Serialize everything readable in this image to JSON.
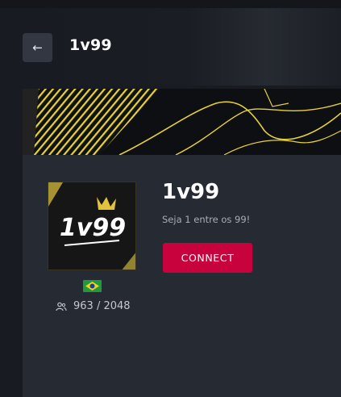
{
  "header": {
    "back_icon": "arrow-left-icon",
    "title": "1v99"
  },
  "server": {
    "name": "1v99",
    "description": "Seja 1 entre os 99!",
    "connect_label": "CONNECT",
    "country_flag": "brazil-flag-icon",
    "players_icon": "users-icon",
    "players_count": "963 / 2048",
    "avatar_text": "1v99",
    "colors": {
      "accent": "#c8023c",
      "banner_stripe": "#e6d23a",
      "panel": "#262a33",
      "background": "#181b22"
    }
  }
}
